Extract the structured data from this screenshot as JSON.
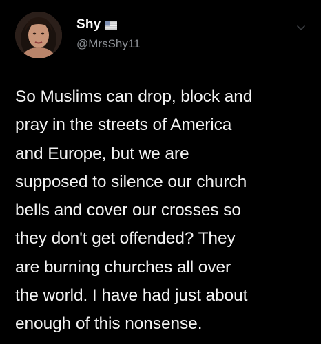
{
  "user": {
    "display_name": "Shy",
    "handle": "@MrsShy11",
    "flag_icon": "us-flag-icon",
    "avatar_icon": "profile-avatar"
  },
  "tweet": {
    "text": "So Muslims can drop, block and\npray in the streets of America\nand Europe, but we are\nsupposed to silence our church\nbells and cover our crosses so\nthey don't get offended? They\nare burning churches all over\nthe world.  I have had just about\nenough of this nonsense."
  },
  "menu": {
    "icon": "chevron-down-icon"
  },
  "colors": {
    "background": "#000000",
    "text": "#f3f3f3",
    "handle": "#8b8f94"
  }
}
